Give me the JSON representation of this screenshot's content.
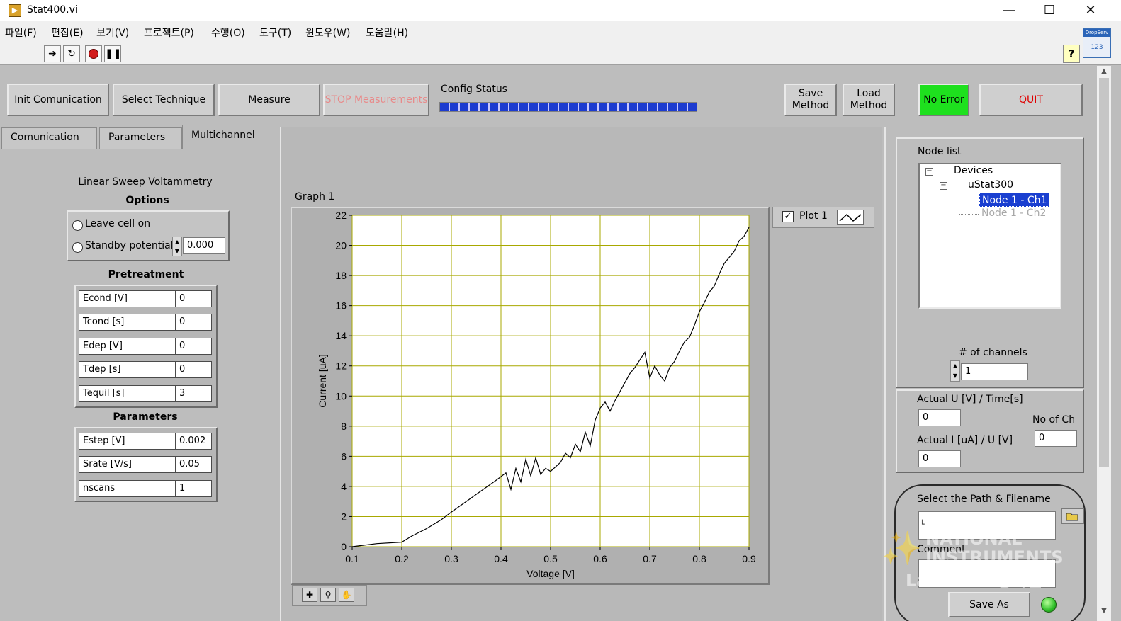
{
  "window": {
    "title": "Stat400.vi",
    "app_icon": "labview-vi-icon",
    "controls": [
      "minimize-icon",
      "maximize-icon",
      "close-icon"
    ]
  },
  "menu": [
    "파일(F)",
    "편집(E)",
    "보기(V)",
    "프로젝트(P)",
    "수행(O)",
    "도구(T)",
    "윈도우(W)",
    "도움말(H)"
  ],
  "toolbar": {
    "icons": [
      "run-arrow-icon",
      "run-continuously-icon",
      "abort-icon",
      "pause-icon",
      "help-icon"
    ],
    "corner_icon_text": "DropServ",
    "corner_icon_value": "123"
  },
  "buttons": {
    "init": "Init Comunication",
    "select_technique": "Select Technique",
    "measure": "Measure",
    "stop": "STOP Measurements",
    "save_method": "Save Method",
    "load_method": "Load Method",
    "no_error": "No Error",
    "quit": "QUIT"
  },
  "config_status": {
    "label": "Config Status",
    "progress": 1.0
  },
  "tabs": {
    "items": [
      "Comunication",
      "Parameters",
      "Multichannel"
    ],
    "active": "Multichannel"
  },
  "technique": {
    "name": "Linear Sweep Voltammetry",
    "options_title": "Options",
    "leave_cell_on": "Leave cell on",
    "standby_potential": "Standby potential",
    "standby_value": "0.000"
  },
  "pretreatment": {
    "title": "Pretreatment",
    "rows": [
      {
        "label": "Econd [V]",
        "value": "0"
      },
      {
        "label": "Tcond [s]",
        "value": "0"
      },
      {
        "label": "Edep [V]",
        "value": "0"
      },
      {
        "label": "Tdep [s]",
        "value": "0"
      },
      {
        "label": "Tequil [s]",
        "value": "3"
      }
    ]
  },
  "parameters": {
    "title": "Parameters",
    "rows": [
      {
        "label": "Estep [V]",
        "value": "0.002"
      },
      {
        "label": "Srate [V/s]",
        "value": "0.05"
      },
      {
        "label": "nscans",
        "value": "1"
      }
    ]
  },
  "graph": {
    "title": "Graph 1",
    "legend_label": "Plot 1",
    "legend_checked": true
  },
  "chart_data": {
    "type": "line",
    "title": "",
    "xlabel": "Voltage [V]",
    "ylabel": "Current [uA]",
    "xlim": [
      0.1,
      0.9
    ],
    "ylim": [
      0,
      22
    ],
    "xticks": [
      "0.1",
      "0.2",
      "0.3",
      "0.4",
      "0.5",
      "0.6",
      "0.7",
      "0.8",
      "0.9"
    ],
    "yticks": [
      "0",
      "2",
      "4",
      "6",
      "8",
      "10",
      "12",
      "14",
      "16",
      "18",
      "20",
      "22"
    ],
    "grid": true,
    "plot_background": "#ffffff",
    "grid_color": "#a8a800",
    "line_color": "#000000",
    "series": [
      {
        "name": "Plot 1",
        "x": [
          0.1,
          0.15,
          0.2,
          0.22,
          0.25,
          0.28,
          0.3,
          0.33,
          0.36,
          0.39,
          0.41,
          0.42,
          0.43,
          0.44,
          0.45,
          0.46,
          0.47,
          0.48,
          0.49,
          0.5,
          0.51,
          0.52,
          0.53,
          0.54,
          0.55,
          0.56,
          0.57,
          0.58,
          0.59,
          0.6,
          0.61,
          0.62,
          0.63,
          0.64,
          0.65,
          0.66,
          0.67,
          0.68,
          0.69,
          0.7,
          0.71,
          0.72,
          0.73,
          0.74,
          0.75,
          0.76,
          0.77,
          0.78,
          0.79,
          0.8,
          0.81,
          0.82,
          0.83,
          0.84,
          0.85,
          0.86,
          0.87,
          0.88,
          0.89,
          0.9
        ],
        "y": [
          0.0,
          0.2,
          0.3,
          0.7,
          1.2,
          1.8,
          2.3,
          3.0,
          3.7,
          4.4,
          4.9,
          3.8,
          5.2,
          4.3,
          5.8,
          4.7,
          5.9,
          4.8,
          5.2,
          5.0,
          5.3,
          5.6,
          6.2,
          5.9,
          6.8,
          6.3,
          7.6,
          6.7,
          8.4,
          9.2,
          9.6,
          9.0,
          9.7,
          10.3,
          10.9,
          11.5,
          11.9,
          12.4,
          12.9,
          11.2,
          12.0,
          11.4,
          11.0,
          11.9,
          12.3,
          13.0,
          13.6,
          13.9,
          14.7,
          15.6,
          16.2,
          16.9,
          17.3,
          18.1,
          18.8,
          19.2,
          19.6,
          20.3,
          20.6,
          21.2
        ]
      }
    ]
  },
  "node_panel": {
    "title": "Node list",
    "tree": {
      "root": "Devices",
      "device": "uStat300",
      "nodes": [
        {
          "label": "Node 1 - Ch1",
          "selected": true
        },
        {
          "label": "Node 1 - Ch2",
          "selected": false
        }
      ]
    },
    "channels_label": "# of channels",
    "channels_value": "1"
  },
  "actuals": {
    "u_label": "Actual U [V] / Time[s]",
    "u_value": "0",
    "i_label": "Actual I [uA] / U [V]",
    "i_value": "0",
    "no_ch_label": "No of Ch",
    "no_ch_value": "0"
  },
  "save": {
    "path_label": "Select the Path & Filename",
    "path_value": "",
    "comment_label": "Comment",
    "comment_value": "",
    "save_as_button": "Save As",
    "led_color": "#30c02a"
  },
  "watermark": {
    "line1": "NATIONAL",
    "line2": "INSTRUMENTS",
    "line3": "LabVIEW 평가판"
  },
  "colors": {
    "no_error_bg": "#1ee01e",
    "quit_text": "#e00000",
    "stop_text": "#e88a8a",
    "progress_fill": "#1c3bd0",
    "selected_node_bg": "#1a3fd0"
  }
}
